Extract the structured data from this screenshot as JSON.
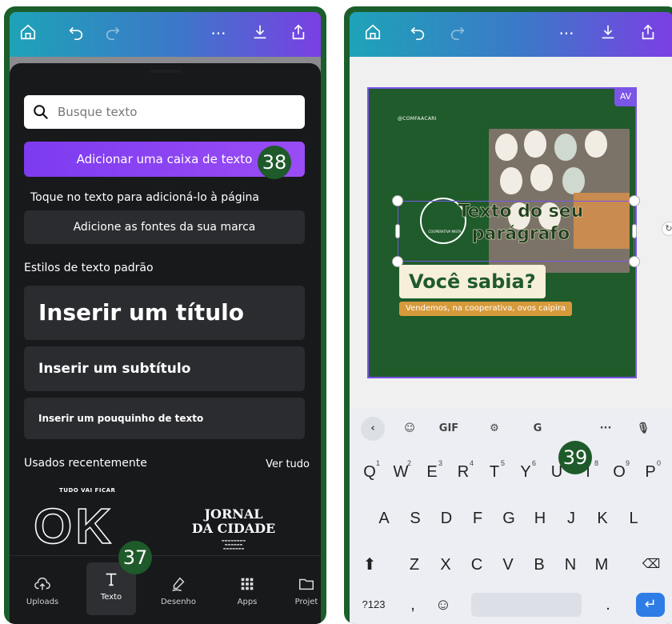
{
  "left": {
    "search_placeholder": "Busque texto",
    "add_textbox": "Adicionar uma caixa de texto",
    "hint": "Toque no texto para adicioná-lo à página",
    "brand_fonts": "Adicione as fontes da sua marca",
    "default_styles_title": "Estilos de texto padrão",
    "style_title": "Inserir um título",
    "style_subtitle": "Inserir um subtítulo",
    "style_body": "Inserir um pouquinho de texto",
    "recent_title": "Usados recentemente",
    "see_all": "Ver tudo",
    "thumb_ok_small": "TUDO VAI FICAR",
    "thumb_ok_big": "OK",
    "thumb_jornal_line1": "JORNAL",
    "thumb_jornal_line2": "DA CIDADE",
    "nav": [
      {
        "label": "Uploads",
        "icon": "cloud-upload-icon"
      },
      {
        "label": "Texto",
        "icon": "text-icon"
      },
      {
        "label": "Desenho",
        "icon": "pen-draw-icon"
      },
      {
        "label": "Apps",
        "icon": "apps-grid-icon"
      },
      {
        "label": "Projet",
        "icon": "folder-icon"
      }
    ]
  },
  "right": {
    "av_tag": "AV",
    "handle_text": "@COMFAACARI",
    "logo_text": "COOPERATIVA MISTA",
    "paragraph_text": "Texto do seu parágrafo",
    "voce_sabia": "Você sabia?",
    "vendemos": "Vendemos, na cooperativa, ovos caipira",
    "kb_tools": {
      "gif": "GIF",
      "more": "···"
    },
    "row1": [
      {
        "k": "Q",
        "n": "1"
      },
      {
        "k": "W",
        "n": "2"
      },
      {
        "k": "E",
        "n": "3"
      },
      {
        "k": "R",
        "n": "4"
      },
      {
        "k": "T",
        "n": "5"
      },
      {
        "k": "Y",
        "n": "6"
      },
      {
        "k": "U",
        "n": "7"
      },
      {
        "k": "I",
        "n": "8"
      },
      {
        "k": "O",
        "n": "9"
      },
      {
        "k": "P",
        "n": "0"
      }
    ],
    "row2": [
      "A",
      "S",
      "D",
      "F",
      "G",
      "H",
      "J",
      "K",
      "L"
    ],
    "row3": [
      "Z",
      "X",
      "C",
      "V",
      "B",
      "N",
      "M"
    ],
    "sym_key": "?123",
    "comma_key": ",",
    "period_key": "."
  },
  "badges": {
    "b37": "37",
    "b38": "38",
    "b39": "39"
  },
  "colors": {
    "badge": "#1e5a2a",
    "accent": "#7d3bf0",
    "design_bg": "#1f5b2b"
  }
}
